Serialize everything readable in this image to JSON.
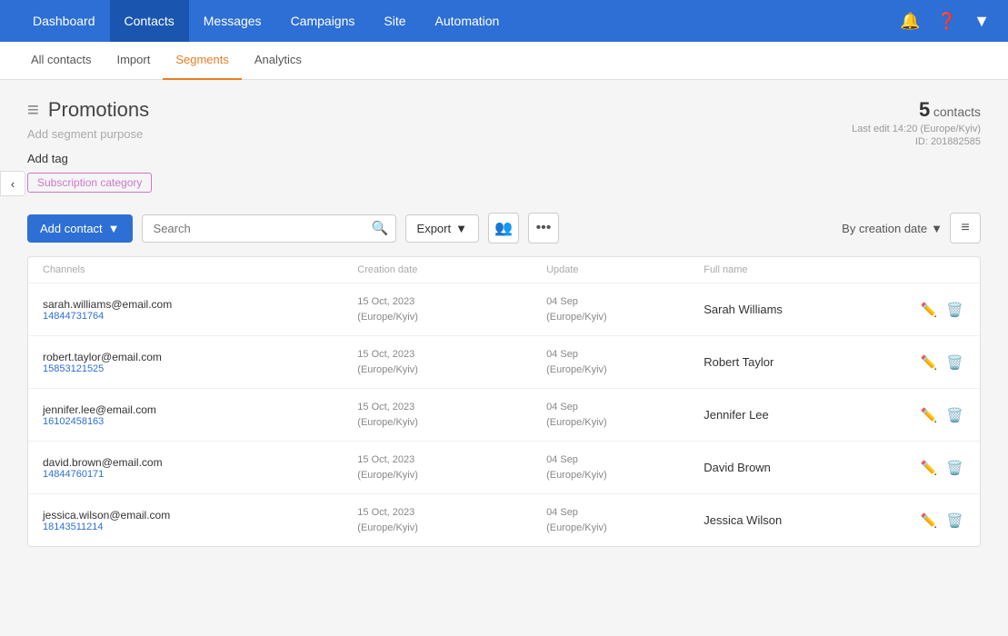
{
  "nav": {
    "items": [
      {
        "label": "Dashboard",
        "active": false
      },
      {
        "label": "Contacts",
        "active": true
      },
      {
        "label": "Messages",
        "active": false
      },
      {
        "label": "Campaigns",
        "active": false
      },
      {
        "label": "Site",
        "active": false
      },
      {
        "label": "Automation",
        "active": false
      }
    ]
  },
  "subnav": {
    "items": [
      {
        "label": "All contacts",
        "active": false
      },
      {
        "label": "Import",
        "active": false
      },
      {
        "label": "Segments",
        "active": true
      },
      {
        "label": "Analytics",
        "active": false
      }
    ]
  },
  "page": {
    "title": "Promotions",
    "segment_purpose": "Add segment purpose",
    "add_tag_label": "Add tag",
    "subscription_category": "Subscription category",
    "contacts_count": "5",
    "contacts_label": "contacts",
    "last_edit": "Last edit 14:20 (Europe/Kyiv)",
    "id_label": "ID: 201882585"
  },
  "toolbar": {
    "add_contact_label": "Add contact",
    "search_placeholder": "Search",
    "export_label": "Export",
    "sort_label": "By creation date"
  },
  "table": {
    "headers": [
      "Channels",
      "Creation date",
      "Update",
      "Full name",
      ""
    ],
    "rows": [
      {
        "email": "sarah.williams@email.com",
        "phone": "14844731764",
        "creation_date": "15 Oct, 2023",
        "creation_tz": "(Europe/Kyiv)",
        "update": "04 Sep",
        "update_tz": "(Europe/Kyiv)",
        "full_name": "Sarah Williams"
      },
      {
        "email": "robert.taylor@email.com",
        "phone": "15853121525",
        "creation_date": "15 Oct, 2023",
        "creation_tz": "(Europe/Kyiv)",
        "update": "04 Sep",
        "update_tz": "(Europe/Kyiv)",
        "full_name": "Robert Taylor"
      },
      {
        "email": "jennifer.lee@email.com",
        "phone": "16102458163",
        "creation_date": "15 Oct, 2023",
        "creation_tz": "(Europe/Kyiv)",
        "update": "04 Sep",
        "update_tz": "(Europe/Kyiv)",
        "full_name": "Jennifer Lee"
      },
      {
        "email": "david.brown@email.com",
        "phone": "14844760171",
        "creation_date": "15 Oct, 2023",
        "creation_tz": "(Europe/Kyiv)",
        "update": "04 Sep",
        "update_tz": "(Europe/Kyiv)",
        "full_name": "David Brown"
      },
      {
        "email": "jessica.wilson@email.com",
        "phone": "18143511214",
        "creation_date": "15 Oct, 2023",
        "creation_tz": "(Europe/Kyiv)",
        "update": "04 Sep",
        "update_tz": "(Europe/Kyiv)",
        "full_name": "Jessica Wilson"
      }
    ]
  }
}
